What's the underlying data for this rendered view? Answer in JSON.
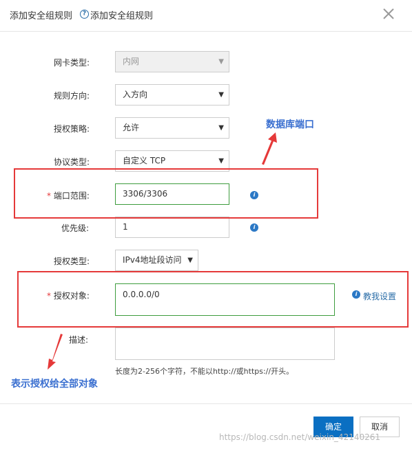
{
  "dialog": {
    "title": "添加安全组规则",
    "help_text": "添加安全组规则",
    "help_icon": "question-circle-icon",
    "close_icon": "close-icon"
  },
  "form": {
    "nic_type": {
      "label": "网卡类型:",
      "value": "内网",
      "disabled": true
    },
    "rule_direction": {
      "label": "规则方向:",
      "value": "入方向"
    },
    "auth_policy": {
      "label": "授权策略:",
      "value": "允许"
    },
    "protocol_type": {
      "label": "协议类型:",
      "value": "自定义 TCP"
    },
    "port_range": {
      "label": "端口范围:",
      "required_mark": "*",
      "value": "3306/3306"
    },
    "priority": {
      "label": "优先级:",
      "value": "1"
    },
    "auth_type": {
      "label": "授权类型:",
      "value": "IPv4地址段访问"
    },
    "auth_object": {
      "label": "授权对象:",
      "required_mark": "*",
      "value": "0.0.0.0/0",
      "help_link": "教我设置"
    },
    "description": {
      "label": "描述:",
      "value": "",
      "hint": "长度为2-256个字符，不能以http://或https://开头。"
    }
  },
  "annotations": {
    "database_port": "数据库端口",
    "all_objects": "表示授权给全部对象"
  },
  "footer": {
    "confirm_label": "确定",
    "cancel_label": "取消"
  },
  "watermark": "https://blog.csdn.net/weixin_42140261",
  "colors": {
    "primary": "#0a6fc2",
    "annotation_red": "#e53939",
    "annotation_blue": "#3a6fd0",
    "valid_green": "#3d9c3d",
    "required": "#e4393c"
  }
}
